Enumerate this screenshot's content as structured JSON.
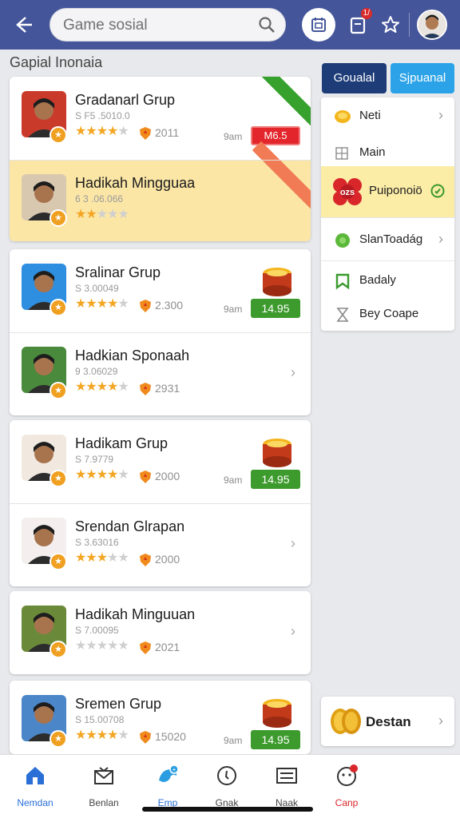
{
  "header": {
    "search_placeholder": "Game sosial",
    "notification_badge": "1/",
    "icons": [
      "back-arrow-icon",
      "search-icon",
      "calendar-icon",
      "notification-icon",
      "star-icon",
      "avatar"
    ]
  },
  "section_title": "Gapial Inonaia",
  "cards": [
    {
      "rows": [
        {
          "title": "Gradanarl Grup",
          "sub": "S F5 .5010.0",
          "stars_on": 4,
          "score": "2011",
          "time": "9am",
          "price": "M6.5",
          "price_style": "red",
          "ribbon": "green",
          "avatar_bg": "#c93a2b"
        },
        {
          "title": "Hadikah Mingguaa",
          "sub": "6 3 .06.066",
          "stars_on": 2,
          "score": "",
          "time": "",
          "price": "",
          "price_style": "none",
          "ribbon": "orange",
          "highlight": true,
          "avatar_bg": "#d8c8b0"
        }
      ]
    },
    {
      "rows": [
        {
          "title": "Sralinar Grup",
          "sub": "S 3.00049",
          "stars_on": 4,
          "score": "2.300",
          "time": "9am",
          "price": "14.95",
          "price_style": "green",
          "coins": true,
          "avatar_bg": "#2e8ee0"
        },
        {
          "title": "Hadkian Sponaah",
          "sub": "9 3.06029",
          "stars_on": 4,
          "score": "2931",
          "time": "",
          "price": "",
          "price_style": "none",
          "chevron": true,
          "avatar_bg": "#4a8a3c"
        }
      ]
    },
    {
      "rows": [
        {
          "title": "Hadikam Grup",
          "sub": "S 7.9779",
          "stars_on": 4,
          "score": "2000",
          "time": "9am",
          "price": "14.95",
          "price_style": "green",
          "coins": true,
          "avatar_bg": "#f1e9e0"
        },
        {
          "title": "Srendan Glrapan",
          "sub": "S 3.63016",
          "stars_on": 3,
          "score": "2000",
          "time": "",
          "price": "",
          "price_style": "none",
          "chevron": true,
          "avatar_bg": "#f4eeee"
        }
      ]
    },
    {
      "rows": [
        {
          "title": "Hadikah Minguuan",
          "sub": "S 7.00095",
          "stars_on": 0,
          "score": "2021",
          "time": "",
          "price": "",
          "price_style": "none",
          "chevron": true,
          "avatar_bg": "#6a8a3a"
        }
      ]
    },
    {
      "rows": [
        {
          "title": "Sremen Grup",
          "sub": "S 15.00708",
          "stars_on": 4,
          "score": "15020",
          "time": "9am",
          "price": "14.95",
          "price_style": "green",
          "coins": true,
          "avatar_bg": "#4b86c8"
        }
      ]
    }
  ],
  "tabs": [
    {
      "label": "Goualal",
      "color": "#1d3c78"
    },
    {
      "label": "Sjpuanal",
      "color": "#2ca3e8"
    }
  ],
  "menu": [
    {
      "label": "Neti",
      "icon": "coin-icon",
      "arrow": true
    },
    {
      "label": "Main",
      "icon": "grid-icon",
      "arrow": false
    },
    {
      "label": "Puiponoiö",
      "icon": "badge-icon",
      "arrow": false,
      "active": true
    },
    {
      "label": "SlanToadág",
      "icon": "clover-icon",
      "arrow": true
    },
    {
      "label": "Badaly",
      "icon": "bookmark-icon",
      "arrow": false
    },
    {
      "label": "Bey Coape",
      "icon": "hourglass-icon",
      "arrow": false
    }
  ],
  "destan": {
    "label": "Destan"
  },
  "bottom_nav": [
    {
      "label": "Nemdan",
      "icon": "home-icon",
      "color": "#2a6fd6"
    },
    {
      "label": "Benlan",
      "icon": "mail-icon",
      "color": "#444444"
    },
    {
      "label": "Emp",
      "icon": "bird-icon",
      "color": "#2a6fd6"
    },
    {
      "label": "Gnak",
      "icon": "clock-icon",
      "color": "#444444"
    },
    {
      "label": "Naak",
      "icon": "list-icon",
      "color": "#444444"
    },
    {
      "label": "Canp",
      "icon": "face-icon",
      "color": "#d8262b"
    }
  ],
  "colors": {
    "header": "#44559a",
    "accent_green": "#3d9a2d",
    "accent_red": "#e3262b",
    "highlight": "#fbe6a6"
  }
}
